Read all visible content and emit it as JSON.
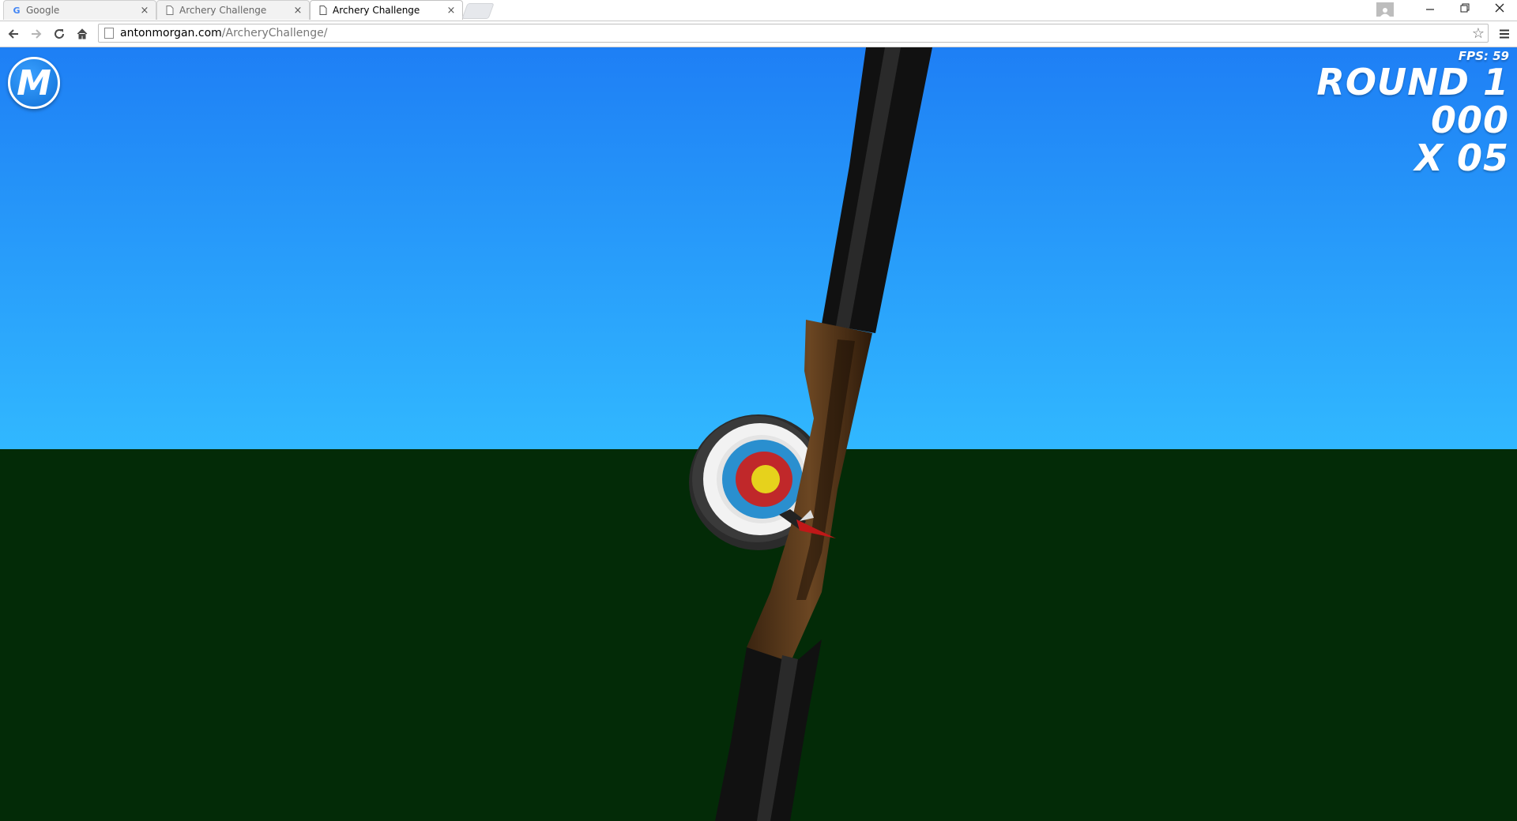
{
  "browser": {
    "tabs": [
      {
        "title": "Google",
        "favicon": "google-g-icon",
        "active": false
      },
      {
        "title": "Archery Challenge",
        "favicon": "page-icon",
        "active": false
      },
      {
        "title": "Archery Challenge",
        "favicon": "page-icon",
        "active": true
      }
    ],
    "tab_close_glyph": "×",
    "url_domain": "antonmorgan.com",
    "url_path": "/ArcheryChallenge/"
  },
  "game": {
    "menu_button_label": "M",
    "fps_text": "FPS: 59",
    "round_text": "ROUND 1",
    "score_text": "000",
    "arrows_text": "X 05",
    "colors": {
      "sky_top": "#1e7ff5",
      "sky_bottom": "#31b8ff",
      "ground": "#032b07",
      "target_gold": "#e6d21c",
      "target_red": "#c0282a",
      "target_blue": "#2a8fcf",
      "bow_limb": "#111111",
      "bow_grip": "#5a3a1c"
    }
  }
}
